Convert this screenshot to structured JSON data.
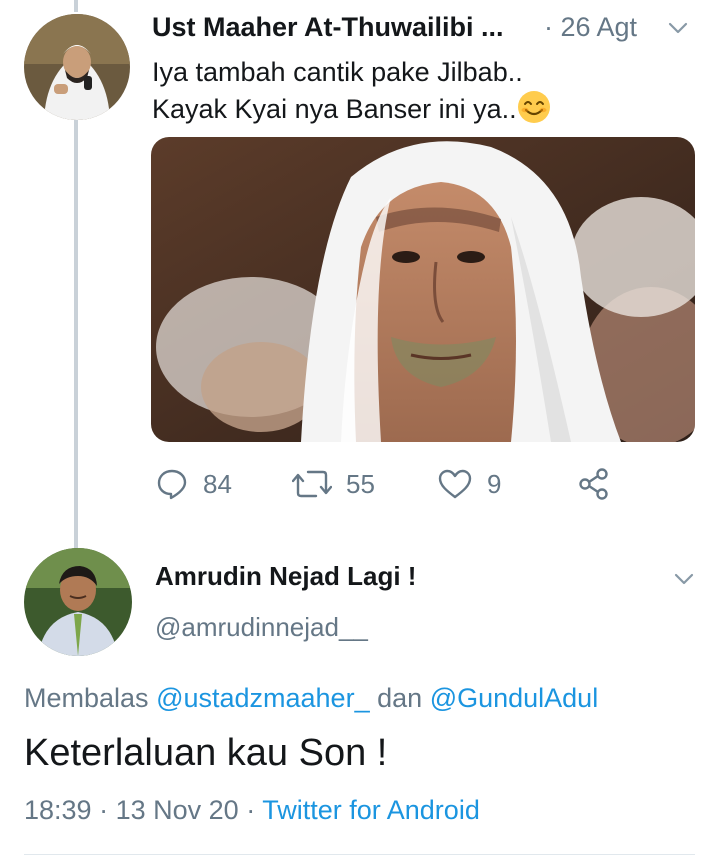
{
  "tweet1": {
    "author_name": "Ust Maaher At-Thuwailibi ...",
    "date": "· 26 Agt",
    "text_line1": "Iya tambah cantik pake Jilbab..",
    "text_line2": "Kayak Kyai nya Banser ini ya..",
    "emoji": "smiling-face-emoji",
    "actions": {
      "reply_count": "84",
      "retweet_count": "55",
      "like_count": "9"
    }
  },
  "tweet2": {
    "author_name": "Amrudin Nejad Lagi !",
    "handle": "@amrudinnejad__",
    "reply_prefix": "Membalas",
    "mention1": "@ustadzmaaher_",
    "reply_conj": "dan",
    "mention2": "@GundulAdul",
    "text": "Keterlaluan kau Son !",
    "time": "18:39",
    "sep1": "·",
    "date": "13 Nov 20",
    "sep2": "·",
    "source": "Twitter for Android"
  },
  "colors": {
    "text": "#14171a",
    "secondary": "#657786",
    "link": "#1b95e0",
    "thread_line": "#c9d1d8"
  }
}
